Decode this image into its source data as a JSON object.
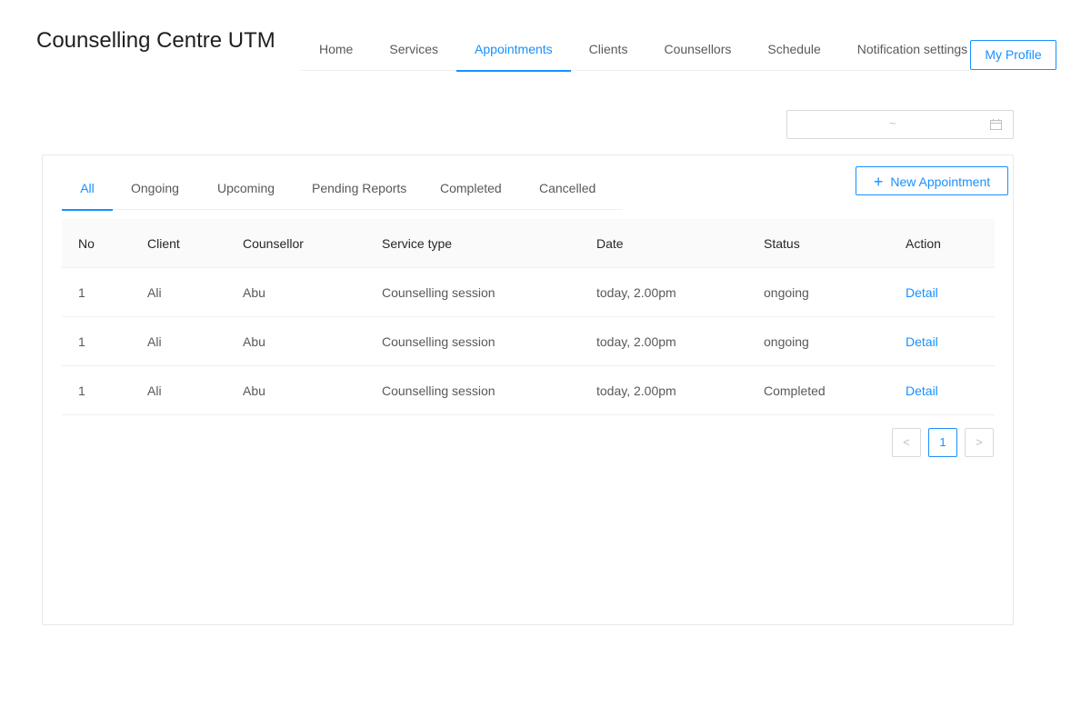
{
  "brand": "Counselling Centre UTM",
  "nav": {
    "items": [
      {
        "label": "Home"
      },
      {
        "label": "Services"
      },
      {
        "label": "Appointments"
      },
      {
        "label": "Clients"
      },
      {
        "label": "Counsellors"
      },
      {
        "label": "Schedule"
      },
      {
        "label": "Notification settings"
      }
    ],
    "active": "Appointments",
    "profile_label": "My Profile"
  },
  "date_range": {
    "separator": "~",
    "icon": "calendar-icon"
  },
  "tabs": [
    {
      "label": "All"
    },
    {
      "label": "Ongoing"
    },
    {
      "label": "Upcoming"
    },
    {
      "label": "Pending Reports"
    },
    {
      "label": "Completed"
    },
    {
      "label": "Cancelled"
    }
  ],
  "active_tab": "All",
  "new_button": {
    "icon": "plus-icon",
    "label": "New Appointment"
  },
  "table": {
    "headers": {
      "no": "No",
      "client": "Client",
      "counsellor": "Counsellor",
      "service": "Service type",
      "date": "Date",
      "status": "Status",
      "action": "Action"
    },
    "rows": [
      {
        "no": "1",
        "client": "Ali",
        "counsellor": "Abu",
        "service": "Counselling session",
        "date": "today, 2.00pm",
        "status": "ongoing",
        "action": "Detail"
      },
      {
        "no": "1",
        "client": "Ali",
        "counsellor": "Abu",
        "service": "Counselling session",
        "date": "today, 2.00pm",
        "status": "ongoing",
        "action": "Detail"
      },
      {
        "no": "1",
        "client": "Ali",
        "counsellor": "Abu",
        "service": "Counselling session",
        "date": "today, 2.00pm",
        "status": "Completed",
        "action": "Detail"
      }
    ]
  },
  "pagination": {
    "prev": "<",
    "current": "1",
    "next": ">"
  },
  "colors": {
    "accent": "#1890ff",
    "border": "#d9d9d9",
    "header_bg": "#fafafa"
  }
}
